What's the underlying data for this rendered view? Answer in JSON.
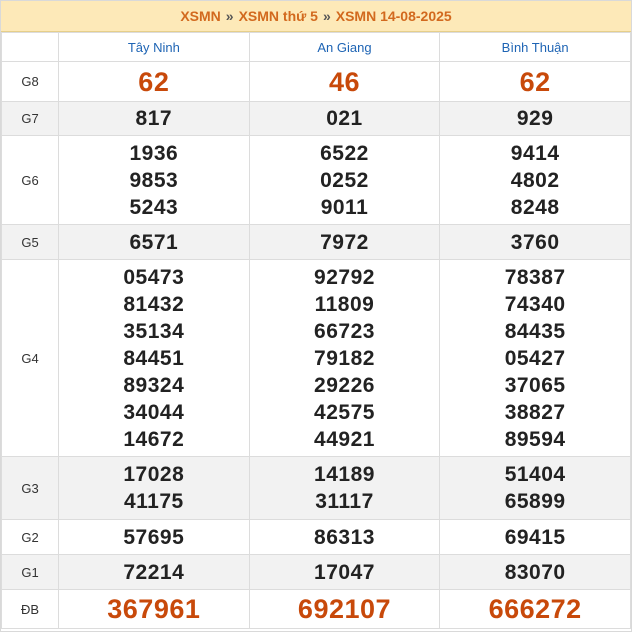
{
  "breadcrumb": {
    "items": [
      "XSMN",
      "XSMN thứ 5",
      "XSMN 14-08-2025"
    ],
    "separator": "»"
  },
  "provinces": [
    "Tây Ninh",
    "An Giang",
    "Bình Thuận"
  ],
  "prizes": [
    {
      "label": "G8",
      "values": [
        [
          "62"
        ],
        [
          "46"
        ],
        [
          "62"
        ]
      ]
    },
    {
      "label": "G7",
      "values": [
        [
          "817"
        ],
        [
          "021"
        ],
        [
          "929"
        ]
      ]
    },
    {
      "label": "G6",
      "values": [
        [
          "1936",
          "9853",
          "5243"
        ],
        [
          "6522",
          "0252",
          "9011"
        ],
        [
          "9414",
          "4802",
          "8248"
        ]
      ]
    },
    {
      "label": "G5",
      "values": [
        [
          "6571"
        ],
        [
          "7972"
        ],
        [
          "3760"
        ]
      ]
    },
    {
      "label": "G4",
      "values": [
        [
          "05473",
          "81432",
          "35134",
          "84451",
          "89324",
          "34044",
          "14672"
        ],
        [
          "92792",
          "11809",
          "66723",
          "79182",
          "29226",
          "42575",
          "44921"
        ],
        [
          "78387",
          "74340",
          "84435",
          "05427",
          "37065",
          "38827",
          "89594"
        ]
      ]
    },
    {
      "label": "G3",
      "values": [
        [
          "17028",
          "41175"
        ],
        [
          "14189",
          "31117"
        ],
        [
          "51404",
          "65899"
        ]
      ]
    },
    {
      "label": "G2",
      "values": [
        [
          "57695"
        ],
        [
          "86313"
        ],
        [
          "69415"
        ]
      ]
    },
    {
      "label": "G1",
      "values": [
        [
          "72214"
        ],
        [
          "17047"
        ],
        [
          "83070"
        ]
      ]
    },
    {
      "label": "ĐB",
      "values": [
        [
          "367961"
        ],
        [
          "692107"
        ],
        [
          "666272"
        ]
      ]
    }
  ],
  "colors": {
    "accent": "#d2691e",
    "header_bg": "#fde9b8",
    "province": "#1e64b4",
    "highlight_number": "#c8490a"
  }
}
